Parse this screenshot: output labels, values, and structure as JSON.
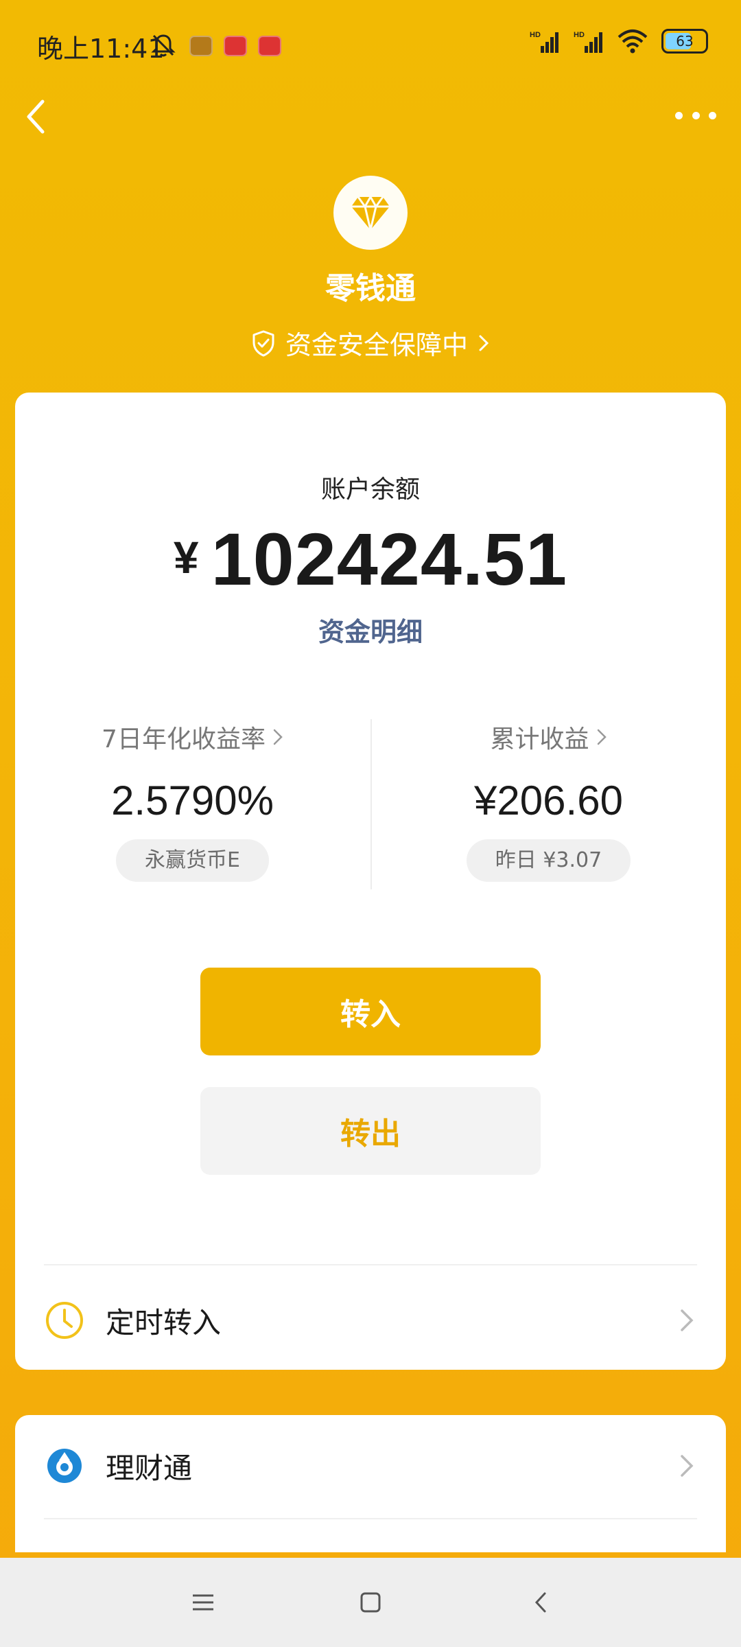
{
  "status_bar": {
    "time": "晚上11:41",
    "battery": "63",
    "icons": [
      "mute-icon",
      "notification-icon",
      "signal-hd-icon",
      "wifi-icon",
      "battery-icon"
    ]
  },
  "header": {
    "title": "零钱通",
    "safety_text": "资金安全保障中",
    "icons": [
      "back-icon",
      "more-icon",
      "diamond-icon",
      "shield-icon"
    ]
  },
  "balance": {
    "label": "账户余额",
    "currency": "¥",
    "amount": "102424.51",
    "details_link": "资金明细"
  },
  "stats": {
    "yield": {
      "label": "7日年化收益率",
      "value": "2.5790%",
      "pill": "永赢货币E"
    },
    "earnings": {
      "label": "累计收益",
      "value": "¥206.60",
      "pill": "昨日 ¥3.07"
    }
  },
  "actions": {
    "transfer_in": "转入",
    "transfer_out": "转出"
  },
  "rows": {
    "scheduled": "定时转入",
    "wealth": "理财通"
  },
  "colors": {
    "accent": "#F0B400",
    "background": "#F2BA03",
    "link": "#50658E"
  }
}
